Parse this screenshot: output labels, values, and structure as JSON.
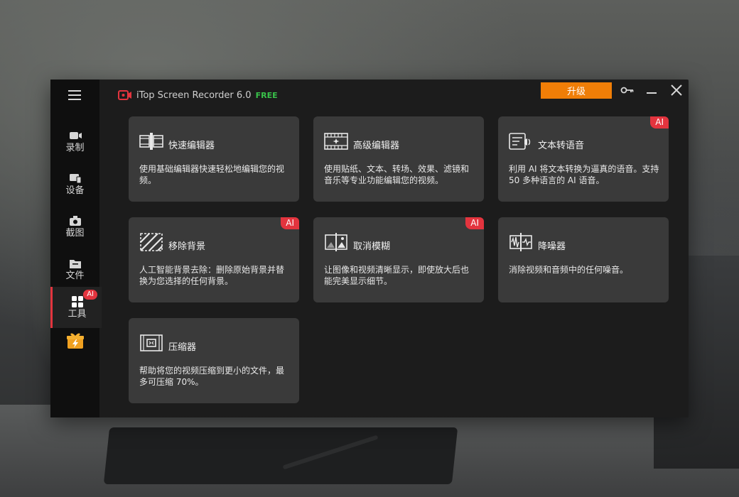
{
  "header": {
    "app_name": "iTop Screen Recorder 6.0",
    "edition": "FREE",
    "upgrade_label": "升级"
  },
  "sidebar": {
    "items": [
      {
        "label": "录制",
        "icon": "camera-record-icon"
      },
      {
        "label": "设备",
        "icon": "devices-icon"
      },
      {
        "label": "截图",
        "icon": "screenshot-camera-icon"
      },
      {
        "label": "文件",
        "icon": "folder-icon"
      },
      {
        "label": "工具",
        "icon": "tools-grid-icon",
        "badge": "AI"
      }
    ],
    "gift_icon": "gift-icon"
  },
  "tools": [
    {
      "name": "快速编辑器",
      "desc": "使用基础编辑器快速轻松地编辑您的视频。",
      "icon": "quick-editor-icon"
    },
    {
      "name": "高级编辑器",
      "desc": "使用贴纸、文本、转场、效果、滤镜和音乐等专业功能编辑您的视频。",
      "icon": "advanced-editor-icon"
    },
    {
      "name": "文本转语音",
      "desc": "利用 AI 将文本转换为逼真的语音。支持 50 多种语言的 AI 语音。",
      "icon": "text-to-speech-icon",
      "badge": "AI"
    },
    {
      "name": "移除背景",
      "desc": "人工智能背景去除：删除原始背景并替换为您选择的任何背景。",
      "icon": "remove-background-icon",
      "badge": "AI"
    },
    {
      "name": "取消模糊",
      "desc": "让图像和视频清晰显示，即使放大后也能完美显示细节。",
      "icon": "unblur-icon",
      "badge": "AI"
    },
    {
      "name": "降噪器",
      "desc": "消除视频和音频中的任何噪音。",
      "icon": "denoise-icon"
    },
    {
      "name": "压缩器",
      "desc": "帮助将您的视频压缩到更小的文件，最多可压缩 70%。",
      "icon": "compressor-icon"
    }
  ],
  "colors": {
    "accent": "#f07e07",
    "badge": "#e3343e",
    "free": "#39c24a",
    "card": "#3a3a3a",
    "window": "#1c1c1c"
  }
}
